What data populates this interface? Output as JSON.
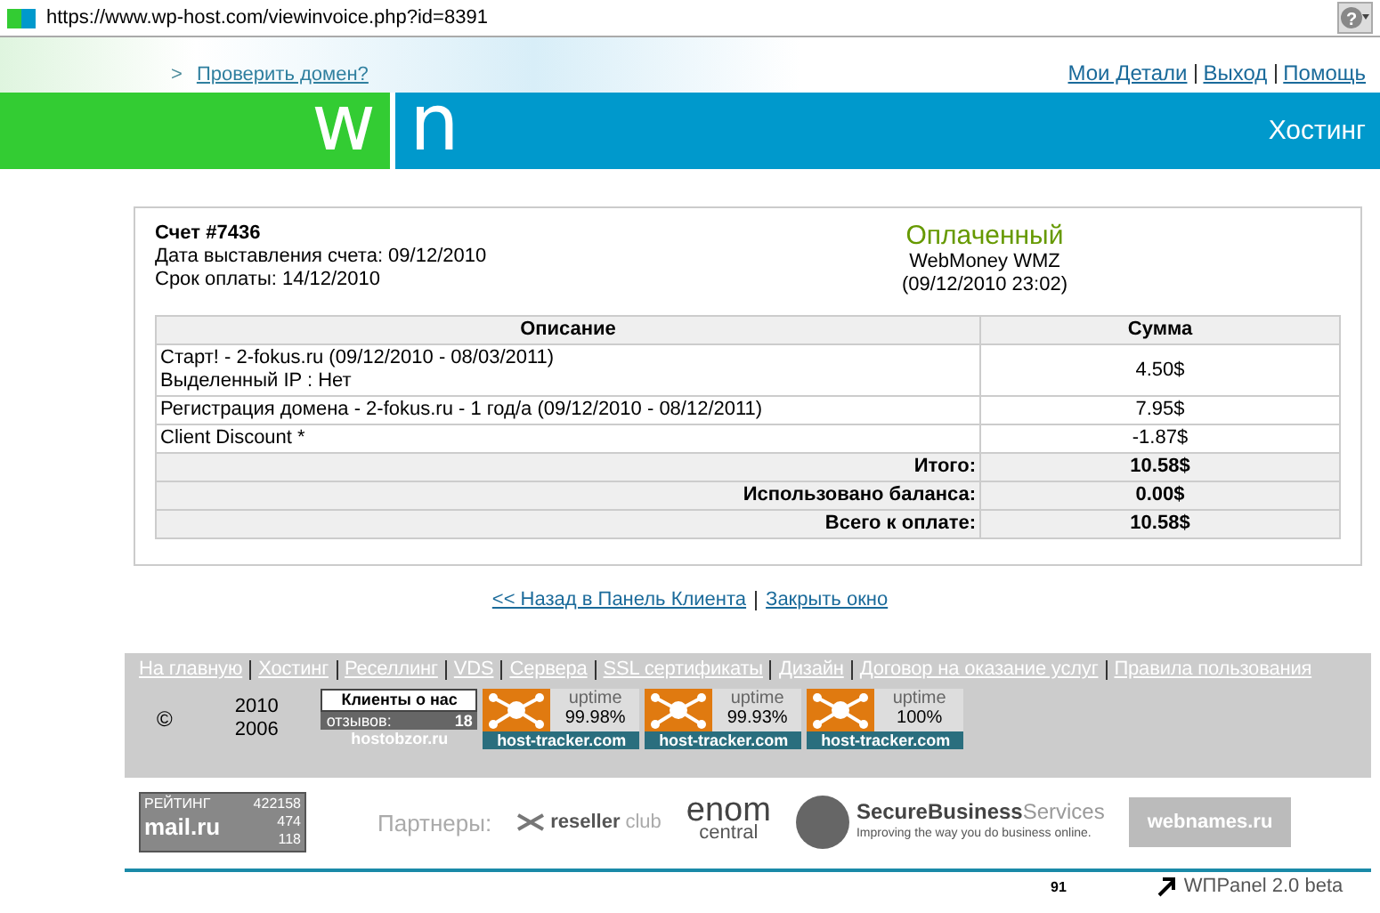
{
  "address_bar": {
    "url": "https://www.wp-host.com/viewinvoice.php?id=8391",
    "help": "?"
  },
  "top_links": {
    "domain_check": "Проверить домен?",
    "prompt": ">",
    "right": [
      "Мои Детали",
      "Выход",
      "Помощь"
    ]
  },
  "banner": {
    "logo_left": "w",
    "logo_right": "n",
    "title": "Хостинг"
  },
  "invoice": {
    "title": "Счет #7436",
    "issued": "Дата выставления счета: 09/12/2010",
    "due": "Срок оплаты: 14/12/2010",
    "status": "Оплаченный",
    "method": "WebMoney WMZ",
    "paid_at": "(09/12/2010 23:02)",
    "columns": [
      "Описание",
      "Сумма"
    ],
    "rows": [
      {
        "kind": "item",
        "lines": [
          "Старт! - 2-fokus.ru (09/12/2010 - 08/03/2011)",
          "Выделенный IP : Нет"
        ],
        "amount": "4.50$"
      },
      {
        "kind": "item",
        "lines": [
          "Регистрация домена - 2-fokus.ru - 1 год/а (09/12/2010 - 08/12/2011)"
        ],
        "amount": "7.95$"
      },
      {
        "kind": "item",
        "lines": [
          "Client Discount *"
        ],
        "amount": "-1.87$"
      },
      {
        "kind": "total",
        "lines": [
          "Итого:"
        ],
        "amount": "10.58$"
      },
      {
        "kind": "total",
        "lines": [
          "Использовано баланса:"
        ],
        "amount": "0.00$"
      },
      {
        "kind": "total",
        "lines": [
          "Всего к оплате:"
        ],
        "amount": "10.58$"
      }
    ]
  },
  "actions": [
    "<< Назад в Панель Клиента",
    "Закрыть окно"
  ],
  "footer": {
    "nav": [
      "На главную",
      "Хостинг",
      "Реселлинг",
      "VDS",
      "Сервера",
      "SSL сертификаты",
      "Дизайн",
      "Договор на оказание услуг",
      "Правила пользования"
    ],
    "copyright": "©",
    "years": [
      "2010",
      "2006"
    ],
    "reviews_badge": {
      "title": "Клиенты о нас",
      "label": "отзывов:",
      "count": "18",
      "site": "hostobzor.ru"
    },
    "uptime_badges": [
      {
        "label": "uptime",
        "value": "99.98%",
        "site": "host-tracker.com"
      },
      {
        "label": "uptime",
        "value": "99.93%",
        "site": "host-tracker.com"
      },
      {
        "label": "uptime",
        "value": "100%",
        "site": "host-tracker.com"
      }
    ],
    "rating": {
      "label": "РЕЙТИНГ",
      "total": "422158",
      "site": "mail.ru",
      "values": [
        "474",
        "118"
      ]
    },
    "partners_label": "Партнеры:",
    "partners": [
      {
        "kind": "reseller",
        "name": "reseller",
        "suffix": "club"
      },
      {
        "kind": "enom",
        "name": "enom",
        "suffix": "central"
      },
      {
        "kind": "secure",
        "name": "SecureBusiness",
        "suffix": "Services",
        "tagline": "Improving the way you do business online."
      },
      {
        "kind": "webnames",
        "name": "webnames.ru"
      }
    ],
    "counter": "91",
    "version": "WПPanel 2.0 beta"
  }
}
